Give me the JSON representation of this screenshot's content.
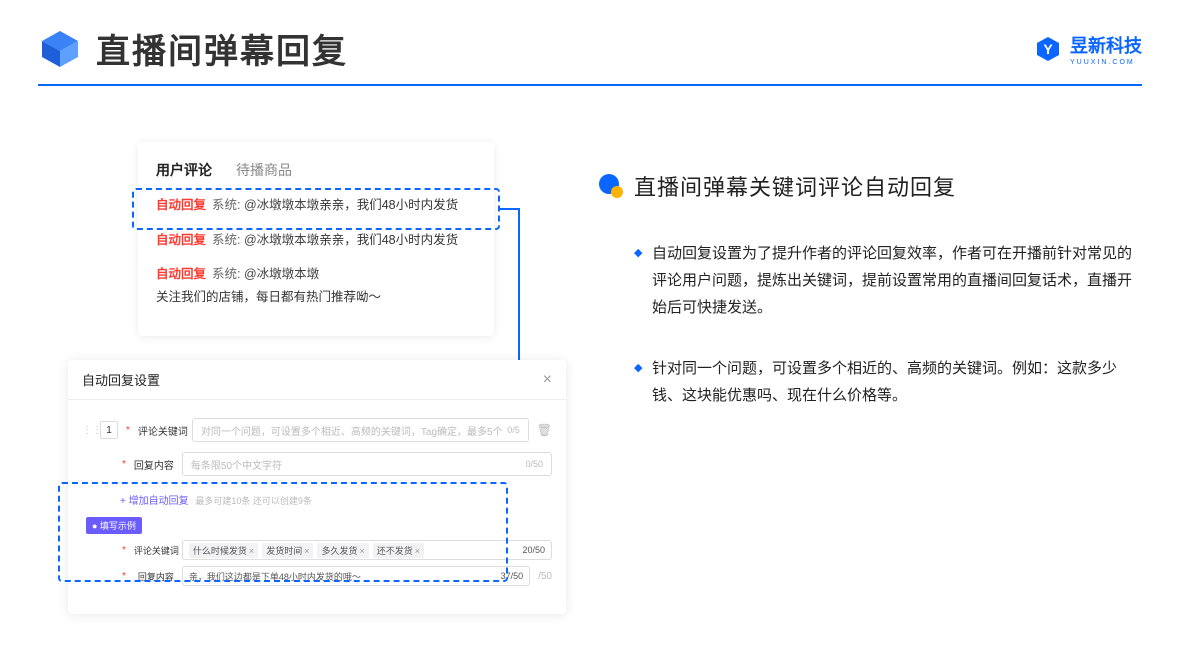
{
  "header": {
    "title": "直播间弹幕回复",
    "brand_name": "昱新科技",
    "brand_sub": "YUUXIN.COM"
  },
  "shot": {
    "tabs": {
      "active": "用户评论",
      "inactive": "待播商品"
    },
    "comments": [
      {
        "badge": "自动回复",
        "prefix": "系统:",
        "mention": "@冰墩墩本墩",
        "text": " 亲亲，我们48小时内发货"
      },
      {
        "badge": "自动回复",
        "prefix": "系统:",
        "mention": "@冰墩墩本墩",
        "text": " 亲亲，我们48小时内发货"
      },
      {
        "badge": "自动回复",
        "prefix": "系统:",
        "mention": "@冰墩墩本墩",
        "text": " 关注我们的店铺，每日都有热门推荐呦～"
      }
    ],
    "modal": {
      "title": "自动回复设置",
      "order": "1",
      "kw_label": "评论关键词",
      "kw_placeholder": "对同一个问题，可设置多个相近、高频的关键词，Tag确定，最多5个",
      "kw_count": "0/5",
      "content_label": "回复内容",
      "content_placeholder": "每条限50个中文字符",
      "content_count": "0/50",
      "add_link": "+ 增加自动回复",
      "add_hint": "最多可建10条 还可以创建9条",
      "example_badge": "● 填写示例",
      "ex_kw_label": "评论关键词",
      "ex_tags": [
        "什么时候发货",
        "发货时间",
        "多久发货",
        "还不发货"
      ],
      "ex_kw_count": "20/50",
      "ex_content_label": "回复内容",
      "ex_content_value": "亲，我们这边都是下单48小时内发货的哦～",
      "ex_content_count": "37/50",
      "outer_count": "/50"
    }
  },
  "right": {
    "title": "直播间弹幕关键词评论自动回复",
    "bullets": [
      "自动回复设置为了提升作者的评论回复效率，作者可在开播前针对常见的评论用户问题，提炼出关键词，提前设置常用的直播间回复话术，直播开始后可快捷发送。",
      "针对同一个问题，可设置多个相近的、高频的关键词。例如：这款多少钱、这块能优惠吗、现在什么价格等。"
    ]
  }
}
